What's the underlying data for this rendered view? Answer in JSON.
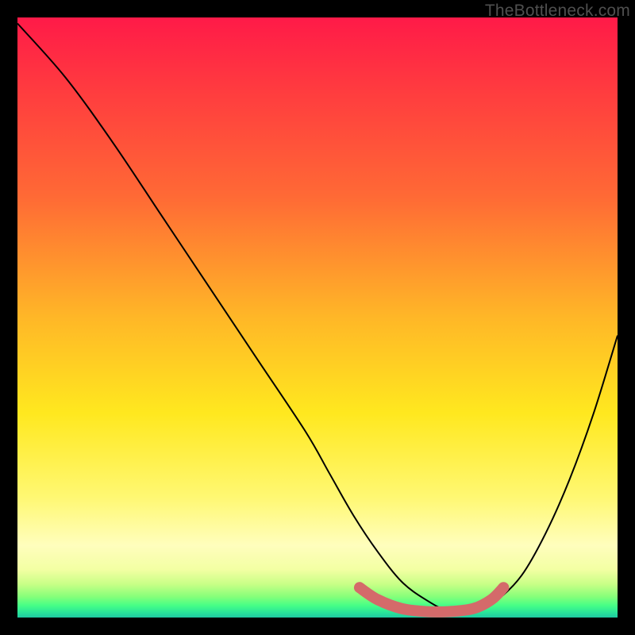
{
  "watermark": "TheBottleneck.com",
  "chart_data": {
    "type": "line",
    "title": "",
    "xlabel": "",
    "ylabel": "",
    "xlim": [
      0,
      100
    ],
    "ylim": [
      0,
      100
    ],
    "series": [
      {
        "name": "bottleneck-curve",
        "color": "#000000",
        "stroke_width": 2,
        "x": [
          0,
          8,
          16,
          24,
          32,
          40,
          48,
          52,
          56,
          60,
          64,
          68,
          72,
          76,
          80,
          84,
          88,
          92,
          96,
          100
        ],
        "values": [
          99,
          90,
          79,
          67,
          55,
          43,
          31,
          24,
          17,
          11,
          6,
          3,
          1,
          1,
          3,
          7,
          14,
          23,
          34,
          47
        ]
      },
      {
        "name": "optimal-zone-marker",
        "color": "#d46a6a",
        "stroke_width": 14,
        "linecap": "round",
        "x": [
          57,
          60,
          64,
          68,
          72,
          76,
          79,
          81
        ],
        "values": [
          5,
          3,
          1.5,
          1,
          1,
          1.5,
          3,
          5
        ]
      }
    ],
    "annotations": []
  }
}
